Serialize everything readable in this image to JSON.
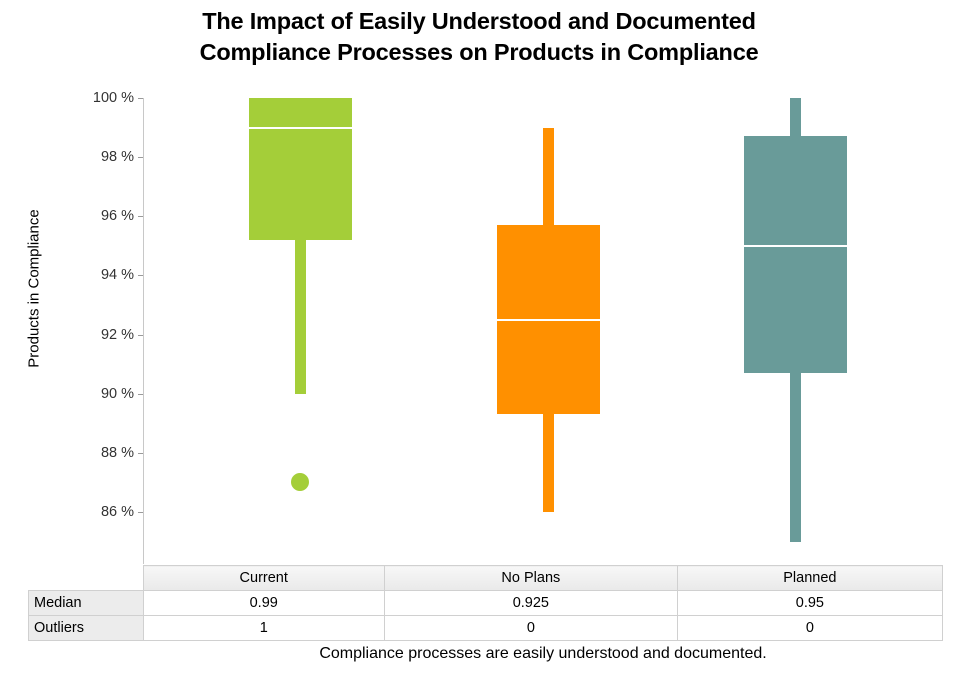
{
  "chart_data": {
    "type": "box",
    "title": "The Impact of Easily Understood and Documented Compliance Processes on Products in Compliance",
    "title_lines": [
      "The Impact of Easily Understood and Documented",
      "Compliance Processes on Products in Compliance"
    ],
    "xlabel": "",
    "ylabel": "Products in Compliance",
    "footer": "Compliance processes are easily understood and documented.",
    "ylim": [
      0.85,
      1.0
    ],
    "y_tick_values": [
      1.0,
      0.98,
      0.96,
      0.94,
      0.92,
      0.9,
      0.88,
      0.86
    ],
    "y_tick_labels": [
      "100 %",
      "98 %",
      "96 %",
      "94 %",
      "92 %",
      "90 %",
      "88 %",
      "86 %"
    ],
    "grid": false,
    "legend": "none",
    "categories": [
      "Current",
      "No Plans",
      "Planned"
    ],
    "boxes": [
      {
        "category": "Current",
        "color": "#A4CE39",
        "whisker_high": 1.0,
        "q3": 1.0,
        "median": 0.99,
        "q1": 0.952,
        "whisker_low": 0.9,
        "outliers": [
          0.87
        ]
      },
      {
        "category": "No Plans",
        "color": "#FF9000",
        "whisker_high": 0.99,
        "q3": 0.957,
        "median": 0.925,
        "q1": 0.893,
        "whisker_low": 0.86,
        "outliers": []
      },
      {
        "category": "Planned",
        "color": "#699B99",
        "whisker_high": 1.0,
        "q3": 0.987,
        "median": 0.95,
        "q1": 0.907,
        "whisker_low": 0.85,
        "outliers": []
      }
    ]
  },
  "table": {
    "corner_label": "",
    "column_headers": [
      "Current",
      "No Plans",
      "Planned"
    ],
    "rows": [
      {
        "label": "Median",
        "values": [
          "0.99",
          "0.925",
          "0.95"
        ]
      },
      {
        "label": "Outliers",
        "values": [
          "1",
          "0",
          "0"
        ]
      }
    ]
  },
  "colors": {
    "current": "#A4CE39",
    "no_plans": "#FF9000",
    "planned": "#699B99",
    "median_line": "#FFFFFF",
    "axis": "#C8C8C8",
    "text": "#000000"
  }
}
